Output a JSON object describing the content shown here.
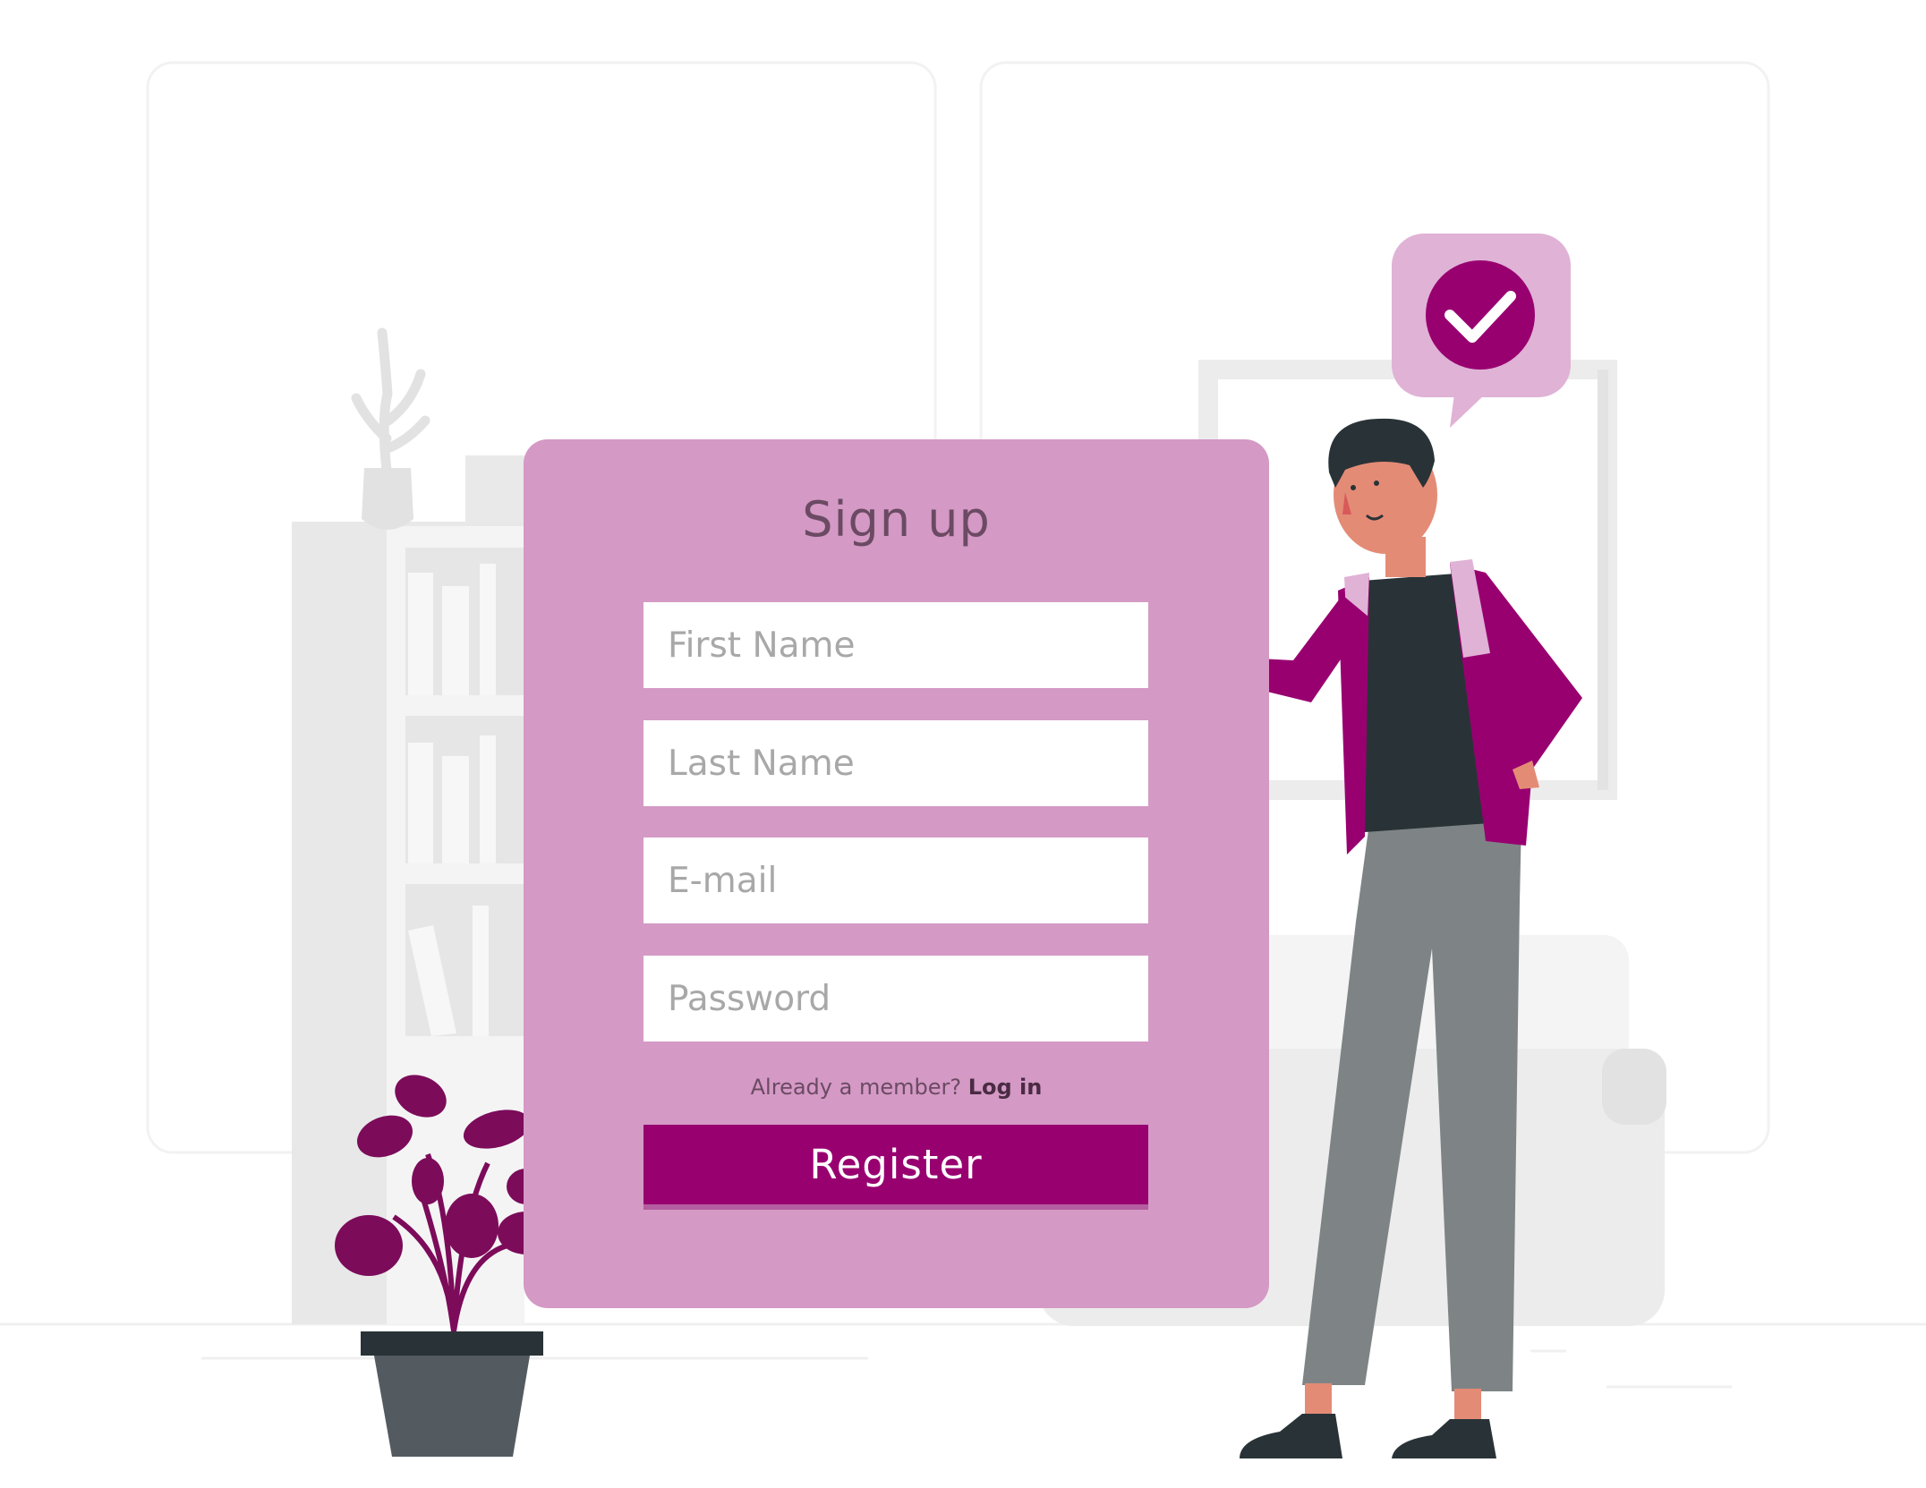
{
  "signup": {
    "title": "Sign up",
    "first_name_placeholder": "First Name",
    "last_name_placeholder": "Last Name",
    "email_placeholder": "E-mail",
    "password_placeholder": "Password",
    "member_text": "Already a member? ",
    "login_link": "Log in",
    "register_label": "Register"
  },
  "colors": {
    "card": "#d499c5",
    "accent": "#980070",
    "bubble": "#e0b2d6",
    "background_shapes": "#ebebeb"
  },
  "icons": [
    "checkmark-icon",
    "speech-bubble-icon",
    "plant-icon",
    "person-illustration"
  ]
}
